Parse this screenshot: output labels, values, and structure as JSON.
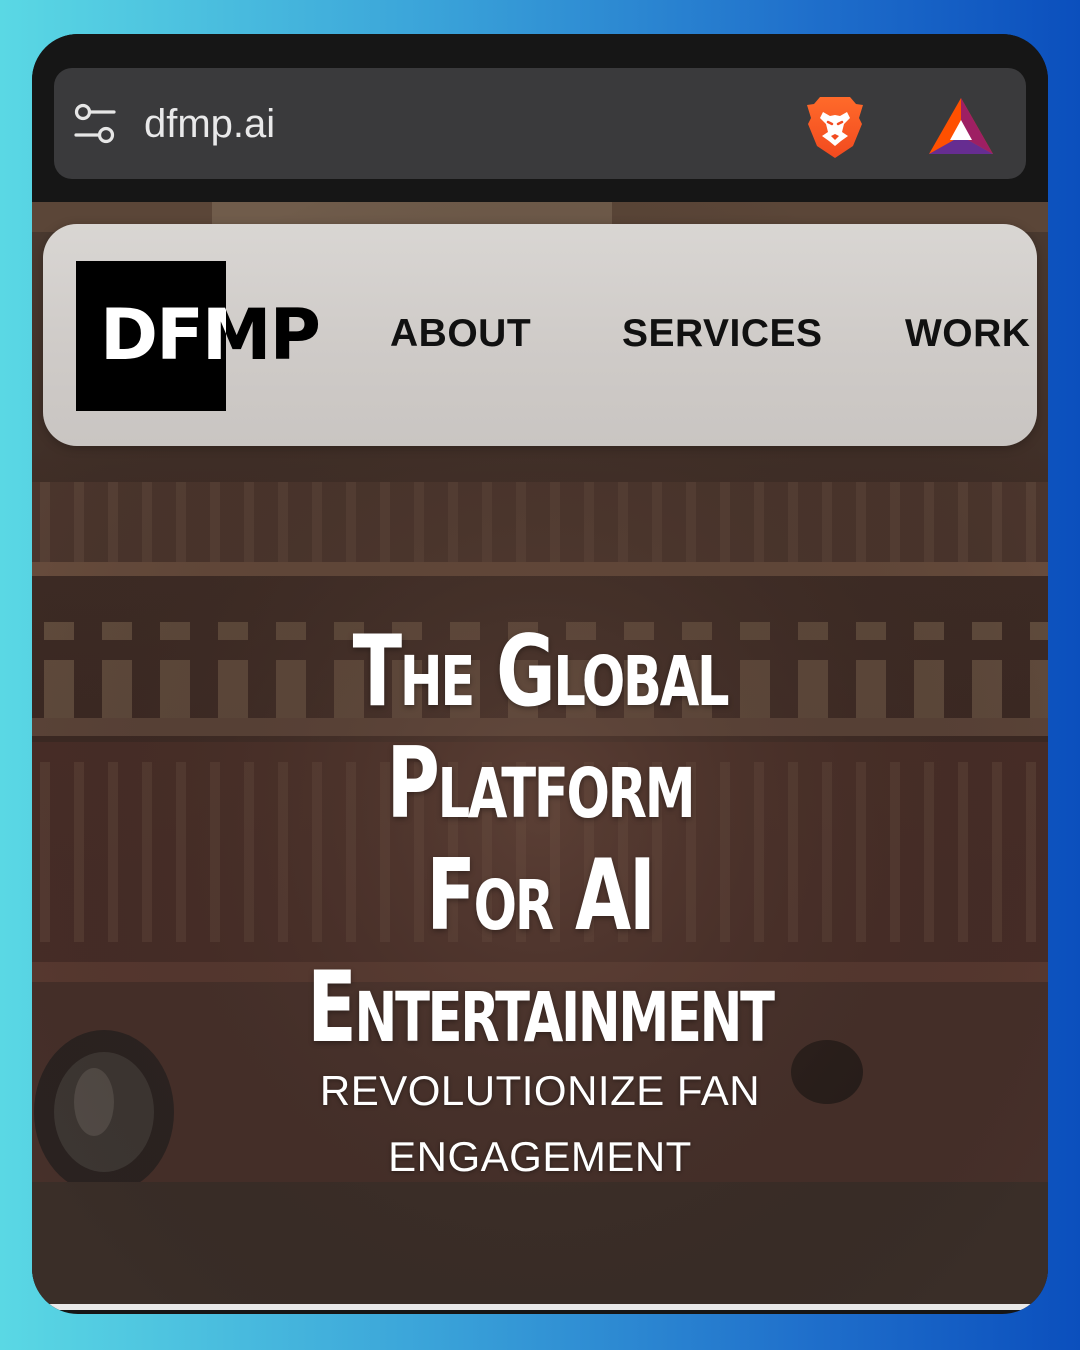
{
  "browser": {
    "url": "dfmp.ai",
    "icons": [
      "tune-icon",
      "brave-lion-icon",
      "bat-rewards-icon"
    ]
  },
  "site": {
    "logo_text": "DFMP",
    "nav": [
      {
        "label": "ABOUT"
      },
      {
        "label": "SERVICES"
      },
      {
        "label": "WORK"
      }
    ],
    "hero": {
      "headline_lines": [
        "The Global",
        "Platform",
        "For AI",
        "Entertainment"
      ],
      "subtitle": "REVOLUTIONIZE FAN ENGAGEMENT"
    }
  },
  "colors": {
    "outer_gradient_start": "#5ad8e4",
    "outer_gradient_end": "#0b4fbd",
    "browser_chrome": "#161616",
    "address_bar": "#3a3a3c",
    "navbar": "#d6d2cf",
    "brave_orange": "#fb542b",
    "hero_text": "#ffffff"
  }
}
